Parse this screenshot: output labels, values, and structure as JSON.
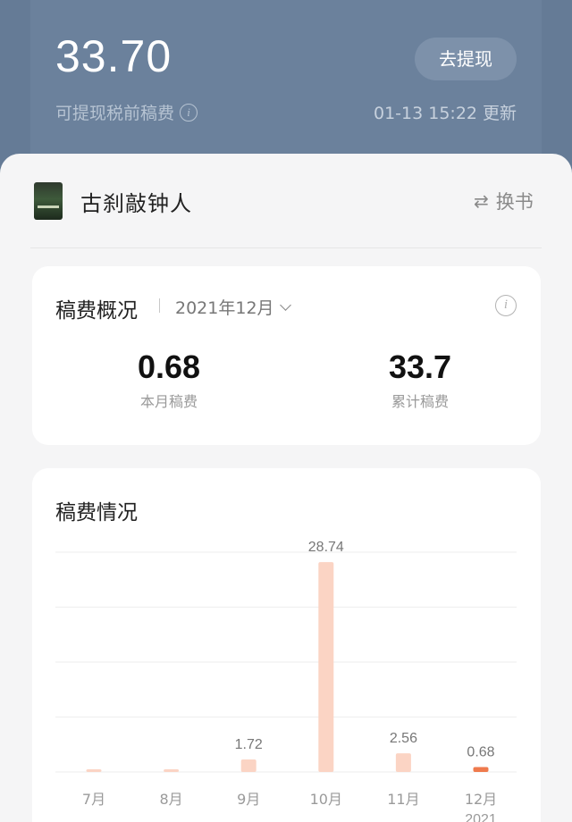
{
  "header": {
    "balance": "33.70",
    "balance_label": "可提现税前稿费",
    "withdraw_button": "去提现",
    "update_time": "01-13 15:22 更新"
  },
  "book": {
    "title": "古刹敲钟人",
    "switch_label": "换书"
  },
  "overview": {
    "title": "稿费概况",
    "selected_month": "2021年12月",
    "month_value": "0.68",
    "month_label": "本月稿费",
    "total_value": "33.7",
    "total_label": "累计稿费"
  },
  "royalty": {
    "title": "稿费情况"
  },
  "chart_data": {
    "type": "bar",
    "categories": [
      "7月",
      "8月",
      "9月",
      "10月",
      "11月",
      "12月"
    ],
    "x_sublabels": [
      "",
      "",
      "",
      "",
      "",
      "2021"
    ],
    "values": [
      0.05,
      0.05,
      1.72,
      28.74,
      2.56,
      0.68
    ],
    "data_labels": [
      "",
      "",
      "1.72",
      "28.74",
      "2.56",
      "0.68"
    ],
    "bar_color": "#fbd4c4",
    "highlight_color": "#ef7a4d",
    "highlight_index": 5,
    "ylim": [
      0,
      35
    ],
    "grid": true
  },
  "colors": {
    "header_bg": "#657b96",
    "accent": "#ef7a4d"
  }
}
